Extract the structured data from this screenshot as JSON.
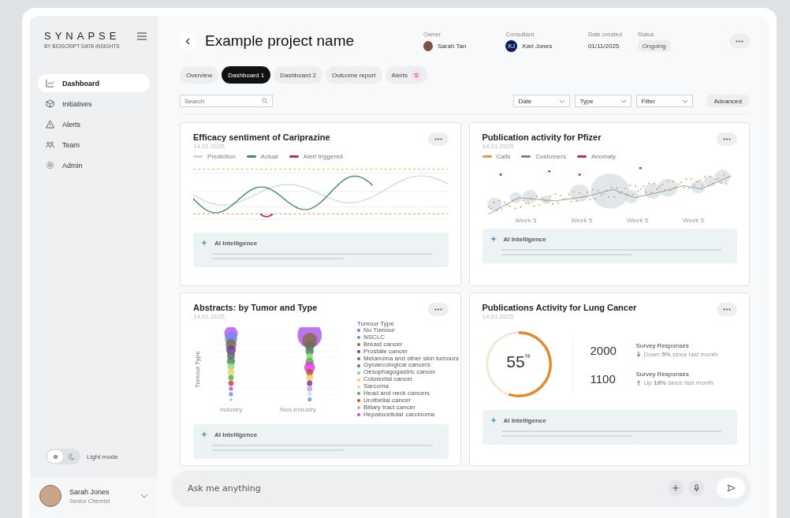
{
  "sidebar": {
    "logo": "SYNAPSE",
    "logo_sub": "BY BIOSCRIPT DATA INSIGHTS",
    "items": [
      {
        "label": "Dashboard",
        "selected": true
      },
      {
        "label": "Initiatives",
        "selected": false
      },
      {
        "label": "Alerts",
        "selected": false
      },
      {
        "label": "Team",
        "selected": false
      },
      {
        "label": "Admin",
        "selected": false
      }
    ],
    "theme": {
      "label": "Light mode",
      "dark": false
    },
    "user": {
      "name": "Sarah Jones",
      "role": "Senior Chemist"
    }
  },
  "header": {
    "title": "Example project name",
    "meta": [
      {
        "label": "Owner",
        "value": "Sarah Tan",
        "kind": "avatar"
      },
      {
        "label": "Consultant",
        "value": "Karl Jones",
        "kind": "initials",
        "initials": "KJ"
      },
      {
        "label": "Date created",
        "value": "01/11/2025",
        "kind": "text"
      },
      {
        "label": "Status",
        "value": "Ongoing",
        "kind": "badge"
      }
    ]
  },
  "tabs": [
    {
      "label": "Overview",
      "selected": false
    },
    {
      "label": "Dashboard 1",
      "selected": true
    },
    {
      "label": "Dashboard 2",
      "selected": false
    },
    {
      "label": "Outcome report",
      "selected": false
    },
    {
      "label": "Alerts",
      "selected": false,
      "count": "5"
    }
  ],
  "search": {
    "placeholder": "Search"
  },
  "filters": [
    "Date",
    "Type",
    "Filter"
  ],
  "advanced": "Advanced",
  "cards": [
    {
      "kind": "line",
      "title": "Efficacy sentiment of Cariprazine",
      "date": "14.01.2025",
      "ai_label": "AI Intelligence",
      "legend": [
        {
          "label": "Prediction",
          "color": "#c9d6dc"
        },
        {
          "label": "Actual",
          "color": "#3f8a72"
        },
        {
          "label": "Alert triggered",
          "color": "#c2266a"
        }
      ]
    },
    {
      "kind": "bubble",
      "title": "Publication activity for Pfizer",
      "date": "14.01.2025",
      "ai_label": "AI Intelligence",
      "legend": [
        {
          "label": "Calls",
          "color": "#e39a3a"
        },
        {
          "label": "Customers",
          "color": "#6e8793"
        },
        {
          "label": "Anomaly",
          "color": "#c2266a"
        }
      ],
      "x_labels": [
        "Week 5",
        "Week 5",
        "Week 5",
        "Week 5"
      ]
    },
    {
      "kind": "tumor",
      "title": "Abstracts: by Tumor and Type",
      "date": "14.01.2025",
      "ai_label": "AI Intelligence",
      "y_label": "Tumour Type",
      "x_labels": [
        "Industry",
        "Non-Industry"
      ],
      "legend_title": "Tumour Type",
      "legend": [
        {
          "label": "No Tumour",
          "color": "#b05ef0"
        },
        {
          "label": "NSCLC",
          "color": "#6b8ff0"
        },
        {
          "label": "Breast cancer",
          "color": "#8b6a4a"
        },
        {
          "label": "Prostate cancer",
          "color": "#6b3fa0"
        },
        {
          "label": "Melanoma and other skin tumours",
          "color": "#6a6a6a"
        },
        {
          "label": "Gynaecological cancers",
          "color": "#4d8a5a"
        },
        {
          "label": "Oesophagogastric cancer",
          "color": "#86e07a"
        },
        {
          "label": "Colorectal cancer",
          "color": "#f0d060"
        },
        {
          "label": "Sarcoma",
          "color": "#cfd8e0"
        },
        {
          "label": "Head and neck cancers",
          "color": "#5bb04b"
        },
        {
          "label": "Urothelial cancer",
          "color": "#c0503a"
        },
        {
          "label": "Biliary tract cancer",
          "color": "#c8a0f0"
        },
        {
          "label": "Hepatocellular carcinoma",
          "color": "#e040e0"
        }
      ]
    },
    {
      "kind": "stats",
      "title": "Publications Activity for Lung Cancer",
      "date": "14.01.2025",
      "ai_label": "AI Intelligence",
      "gauge": {
        "level": 0.55,
        "value": "55",
        "unit": "%"
      },
      "stats": [
        {
          "value": "2000",
          "label": "Survey Responses",
          "up": false,
          "note": "Down **5%** since last month"
        },
        {
          "value": "1100",
          "label": "Survey Responses",
          "up": true,
          "note": "Up **18%** since last month"
        }
      ]
    }
  ],
  "chat": {
    "placeholder": "Ask me anything"
  }
}
